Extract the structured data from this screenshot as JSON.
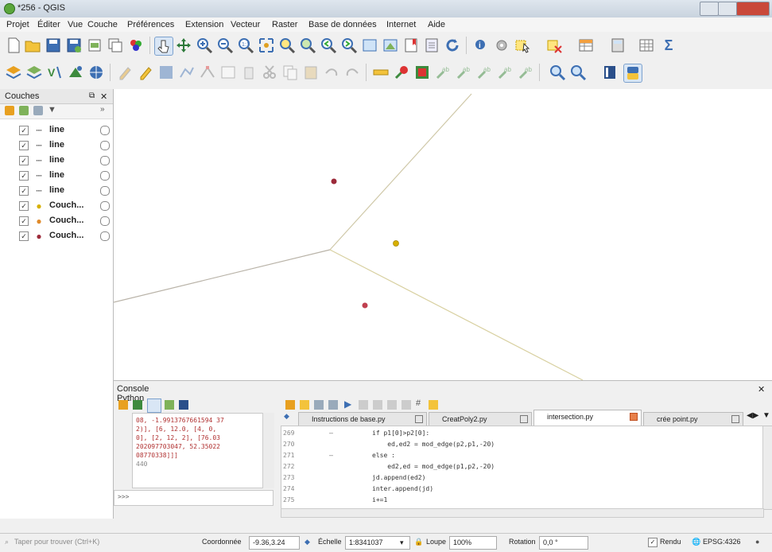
{
  "window": {
    "title": "*256 - QGIS"
  },
  "menu": [
    "Projet",
    "Éditer",
    "Vue",
    "Couche",
    "Préférences",
    "Extension",
    "Vecteur",
    "Raster",
    "Base de données",
    "Internet",
    "Aide"
  ],
  "toolbar1": {
    "sigma": "Σ"
  },
  "layers_panel": {
    "title": "Couches",
    "layers": [
      {
        "label": "line",
        "symbol": "line",
        "checked": "✓"
      },
      {
        "label": "line",
        "symbol": "line",
        "checked": "✓"
      },
      {
        "label": "line",
        "symbol": "line",
        "checked": "✓"
      },
      {
        "label": "line",
        "symbol": "line",
        "checked": "✓"
      },
      {
        "label": "line",
        "symbol": "line",
        "checked": "✓"
      },
      {
        "label": "Couch...",
        "symbol": "point",
        "checked": "✓",
        "color": "#d7b000"
      },
      {
        "label": "Couch...",
        "symbol": "point",
        "checked": "✓",
        "color": "#e08a2a"
      },
      {
        "label": "Couch...",
        "symbol": "point",
        "checked": "✓",
        "color": "#9c2a3a"
      }
    ]
  },
  "console": {
    "title": "Console Python",
    "output": [
      "08, -1.9913767661594 37",
      "2)], [6, 12.0, [4, 0,",
      "0], [2, 12, 2], [76.03",
      "202097703047, 52.35022",
      "08770338]]]",
      "",
      "440"
    ],
    "prompt": ">>>",
    "tabs": [
      "Instructions de base.py",
      "CreatPoly2.py",
      "intersection.py",
      "crée point.py"
    ],
    "line_numbers": [
      "269",
      "270",
      "271",
      "272",
      "273",
      "274",
      "275"
    ],
    "code_lines": [
      "if p1[0]>p2[0]:",
      "    ed,ed2 = mod_edge(p2,p1,-20)",
      "else :",
      "    ed2,ed = mod_edge(p1,p2,-20)",
      "jd.append(ed2)",
      "inter.append(jd)",
      "i+=1"
    ]
  },
  "statusbar": {
    "search_placeholder": "Taper pour trouver (Ctrl+K)",
    "coordinate_label": "Coordonnée",
    "coordinate_value": "-9.36,3.24",
    "scale_label": "Échelle",
    "scale_value": "1:8341037",
    "magnifier_label": "Loupe",
    "magnifier_value": "100%",
    "rotation_label": "Rotation",
    "rotation_value": "0,0 °",
    "render_label": "Rendu",
    "crs": "EPSG:4326"
  },
  "colors": {
    "accent": "#3d6fb3",
    "line": "#c8c0a8"
  }
}
